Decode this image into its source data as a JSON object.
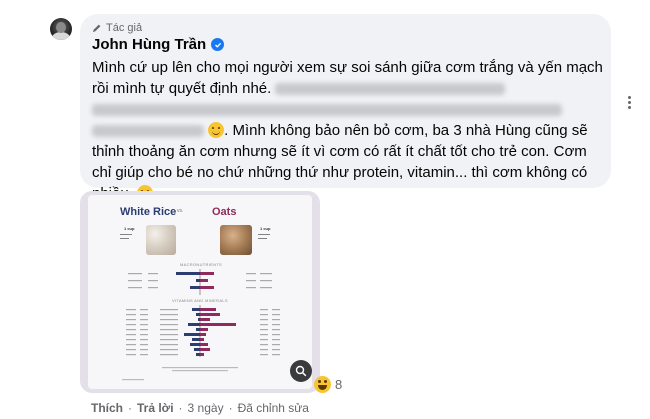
{
  "comment": {
    "author_tag": "Tác giả",
    "author_name": "John Hùng Trần",
    "line1": "Mình cứ up lên cho mọi người xem sự soi sánh giữa cơm trắng và yến mạch",
    "line2": "rồi mình tự quyết định nhé.",
    "line3_visible": ". Mình không bảo nên bỏ cơm, ba 3 nhà Hùng cũng sẽ",
    "line4": "thỉnh thoảng ăn cơm nhưng sẽ ít vì cơm có rất ít chất tốt cho trẻ con. Cơm",
    "line5": "chỉ giúp cho bé no chứ những thứ như protein, vitamin... thì cơm không có",
    "line6": "nhiều.",
    "emoji": "slightly-smiling-face"
  },
  "image": {
    "title_left": "White Rice",
    "title_vs": "vs.",
    "title_right": "Oats",
    "left_cup": "1 cup",
    "right_cup": "1 cup",
    "section_macro": "MACRONUTRIENTS",
    "section_vitamins": "VITAMINS AND MINERALS",
    "colors": {
      "rice": "#2c3e70",
      "oats": "#8e2b5c"
    }
  },
  "reactions": {
    "emoji": "laughing-face",
    "count": "8"
  },
  "actions": {
    "like": "Thích",
    "reply": "Trả lời",
    "time": "3 ngày",
    "edited": "Đã chỉnh sửa"
  }
}
